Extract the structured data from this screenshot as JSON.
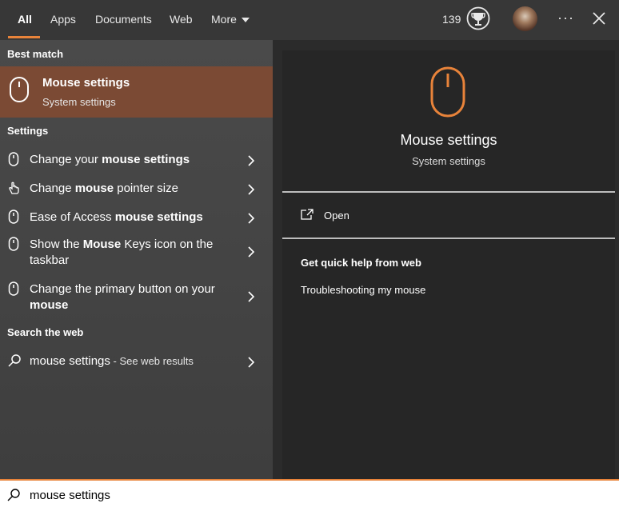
{
  "tabs": [
    {
      "label": "All",
      "active": true
    },
    {
      "label": "Apps"
    },
    {
      "label": "Documents"
    },
    {
      "label": "Web"
    },
    {
      "label": "More"
    }
  ],
  "header": {
    "points": "139",
    "trophy_icon": "trophy-icon",
    "ellipsis": "···",
    "accent_color": "#e8833a"
  },
  "left": {
    "best_match_label": "Best match",
    "best_match": {
      "title": "Mouse settings",
      "subtitle": "System settings",
      "icon": "mouse-icon",
      "bg_color": "#7b4a34"
    },
    "settings_label": "Settings",
    "settings_items": [
      {
        "parts": [
          [
            "Change your ",
            false
          ],
          [
            "mouse settings",
            true
          ]
        ],
        "icon": "mouse-icon"
      },
      {
        "parts": [
          [
            "Change ",
            false
          ],
          [
            "mouse",
            true
          ],
          [
            " pointer size",
            false
          ]
        ],
        "icon": "pointer-hand-icon"
      },
      {
        "parts": [
          [
            "Ease of Access ",
            false
          ],
          [
            "mouse settings",
            true
          ]
        ],
        "icon": "mouse-icon"
      },
      {
        "parts": [
          [
            "Show the ",
            false
          ],
          [
            "Mouse",
            true
          ],
          [
            " Keys icon on the taskbar",
            false
          ]
        ],
        "icon": "mouse-icon"
      },
      {
        "parts": [
          [
            "Change the primary button on your ",
            false
          ],
          [
            "mouse",
            true
          ]
        ],
        "icon": "mouse-icon"
      }
    ],
    "web_label": "Search the web",
    "web_item": {
      "query": "mouse settings",
      "suffix": " - See web results",
      "icon": "search-icon"
    }
  },
  "preview": {
    "icon": "mouse-icon",
    "title": "Mouse settings",
    "subtitle": "System settings",
    "open_label": "Open",
    "help_title": "Get quick help from web",
    "help_links": [
      "Troubleshooting my mouse"
    ]
  },
  "search": {
    "value": "mouse settings",
    "placeholder": ""
  }
}
